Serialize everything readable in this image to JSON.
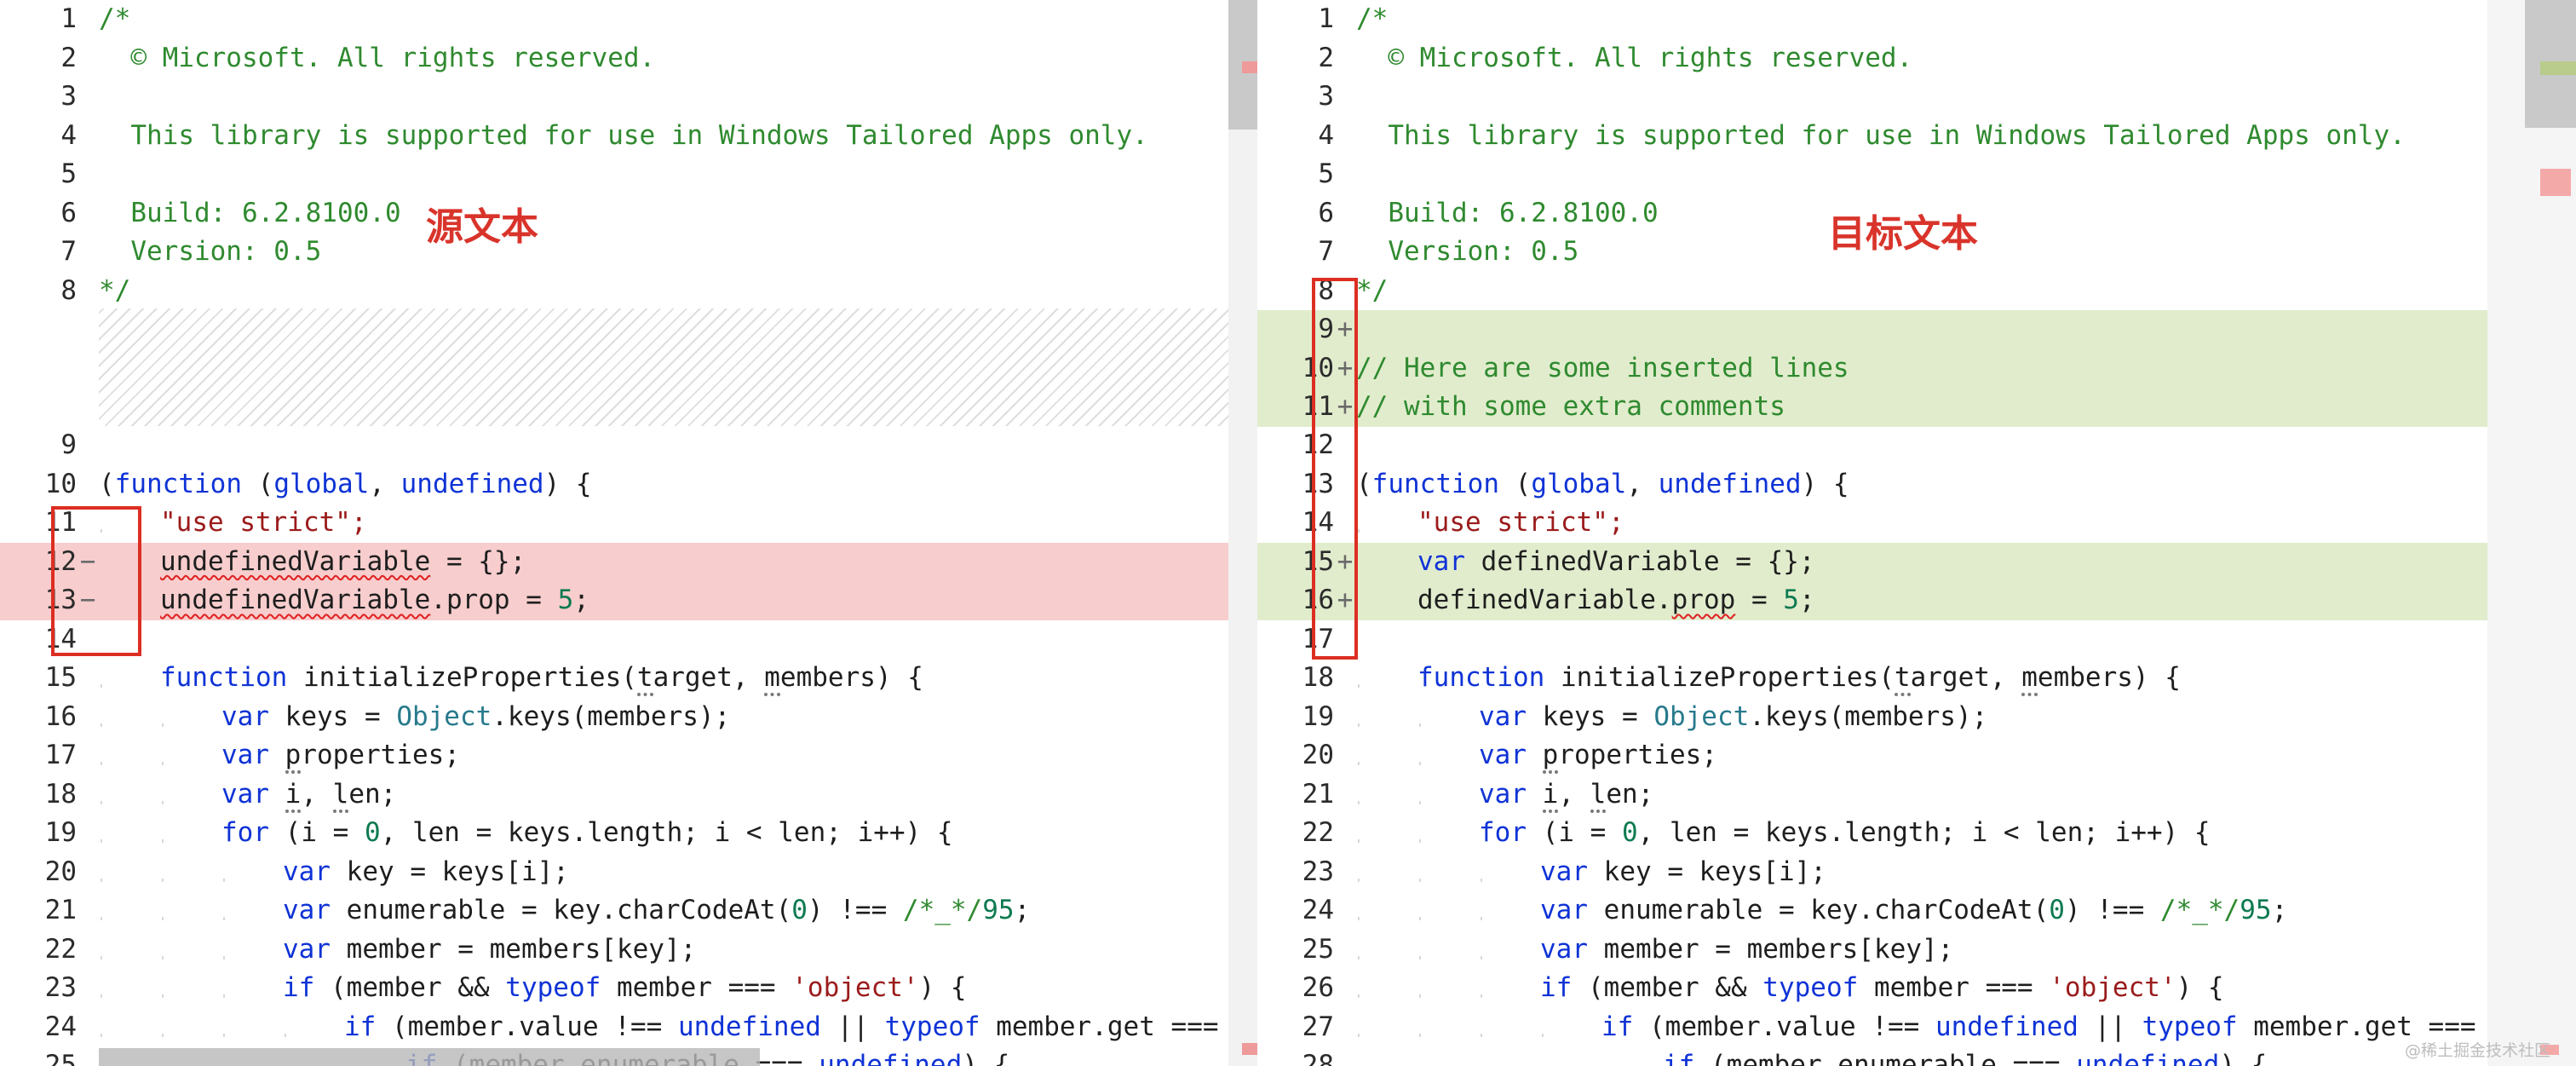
{
  "annotations": {
    "source_label": "源文本",
    "target_label": "目标文本"
  },
  "watermark": "@稀土掘金技术社区",
  "colors": {
    "deleted_bg": "#f7cdcd",
    "inserted_bg": "#e1eccd",
    "annotation_red": "#d9342b",
    "comment": "#2f8a2f",
    "keyword": "#0f33d6",
    "string": "#9b1b1b"
  },
  "left": {
    "lines": [
      {
        "n": "1",
        "m": "",
        "t": "/*"
      },
      {
        "n": "2",
        "m": "",
        "t": "  © Microsoft. All rights reserved."
      },
      {
        "n": "3",
        "m": "",
        "t": ""
      },
      {
        "n": "4",
        "m": "",
        "t": "  This library is supported for use in Windows Tailored Apps only."
      },
      {
        "n": "5",
        "m": "",
        "t": ""
      },
      {
        "n": "6",
        "m": "",
        "t": "  Build: 6.2.8100.0"
      },
      {
        "n": "7",
        "m": "",
        "t": "  Version: 0.5"
      },
      {
        "n": "8",
        "m": "",
        "t": "*/"
      },
      {
        "n": "9",
        "m": "",
        "t": ""
      },
      {
        "n": "10",
        "m": "",
        "t": "(function (global, undefined) {"
      },
      {
        "n": "11",
        "m": "",
        "t": "\"use strict\";"
      },
      {
        "n": "12",
        "m": "−",
        "t": "undefinedVariable = {};"
      },
      {
        "n": "13",
        "m": "−",
        "t": "undefinedVariable.prop = 5;"
      },
      {
        "n": "14",
        "m": "",
        "t": ""
      },
      {
        "n": "15",
        "m": "",
        "t": "function initializeProperties(target, members) {"
      },
      {
        "n": "16",
        "m": "",
        "t": "var keys = Object.keys(members);"
      },
      {
        "n": "17",
        "m": "",
        "t": "var properties;"
      },
      {
        "n": "18",
        "m": "",
        "t": "var i, len;"
      },
      {
        "n": "19",
        "m": "",
        "t": "for (i = 0, len = keys.length; i < len; i++) {"
      },
      {
        "n": "20",
        "m": "",
        "t": "var key = keys[i];"
      },
      {
        "n": "21",
        "m": "",
        "t": "var enumerable = key.charCodeAt(0) !== /*_*/95;"
      },
      {
        "n": "22",
        "m": "",
        "t": "var member = members[key];"
      },
      {
        "n": "23",
        "m": "",
        "t": "if (member && typeof member === 'object') {"
      },
      {
        "n": "24",
        "m": "",
        "t": "if (member.value !== undefined || typeof member.get === 'fu"
      },
      {
        "n": "25",
        "m": "",
        "t": "if (member.enumerable === undefined) {"
      }
    ]
  },
  "right": {
    "lines": [
      {
        "n": "1",
        "m": "",
        "t": "/*"
      },
      {
        "n": "2",
        "m": "",
        "t": "  © Microsoft. All rights reserved."
      },
      {
        "n": "3",
        "m": "",
        "t": ""
      },
      {
        "n": "4",
        "m": "",
        "t": "  This library is supported for use in Windows Tailored Apps only."
      },
      {
        "n": "5",
        "m": "",
        "t": ""
      },
      {
        "n": "6",
        "m": "",
        "t": "  Build: 6.2.8100.0"
      },
      {
        "n": "7",
        "m": "",
        "t": "  Version: 0.5"
      },
      {
        "n": "8",
        "m": "",
        "t": "*/"
      },
      {
        "n": "9",
        "m": "+",
        "t": ""
      },
      {
        "n": "10",
        "m": "+",
        "t": "// Here are some inserted lines"
      },
      {
        "n": "11",
        "m": "+",
        "t": "// with some extra comments"
      },
      {
        "n": "12",
        "m": "",
        "t": ""
      },
      {
        "n": "13",
        "m": "",
        "t": "(function (global, undefined) {"
      },
      {
        "n": "14",
        "m": "",
        "t": "\"use strict\";"
      },
      {
        "n": "15",
        "m": "+",
        "t": "var definedVariable = {};"
      },
      {
        "n": "16",
        "m": "+",
        "t": "definedVariable.prop = 5;"
      },
      {
        "n": "17",
        "m": "",
        "t": ""
      },
      {
        "n": "18",
        "m": "",
        "t": "function initializeProperties(target, members) {"
      },
      {
        "n": "19",
        "m": "",
        "t": "var keys = Object.keys(members);"
      },
      {
        "n": "20",
        "m": "",
        "t": "var properties;"
      },
      {
        "n": "21",
        "m": "",
        "t": "var i, len;"
      },
      {
        "n": "22",
        "m": "",
        "t": "for (i = 0, len = keys.length; i < len; i++) {"
      },
      {
        "n": "23",
        "m": "",
        "t": "var key = keys[i];"
      },
      {
        "n": "24",
        "m": "",
        "t": "var enumerable = key.charCodeAt(0) !== /*_*/95;"
      },
      {
        "n": "25",
        "m": "",
        "t": "var member = members[key];"
      },
      {
        "n": "26",
        "m": "",
        "t": "if (member && typeof member === 'object') {"
      },
      {
        "n": "27",
        "m": "",
        "t": "if (member.value !== undefined || typeof member.get === 'fu"
      },
      {
        "n": "28",
        "m": "",
        "t": "if (member.enumerable === undefined) {"
      }
    ]
  }
}
